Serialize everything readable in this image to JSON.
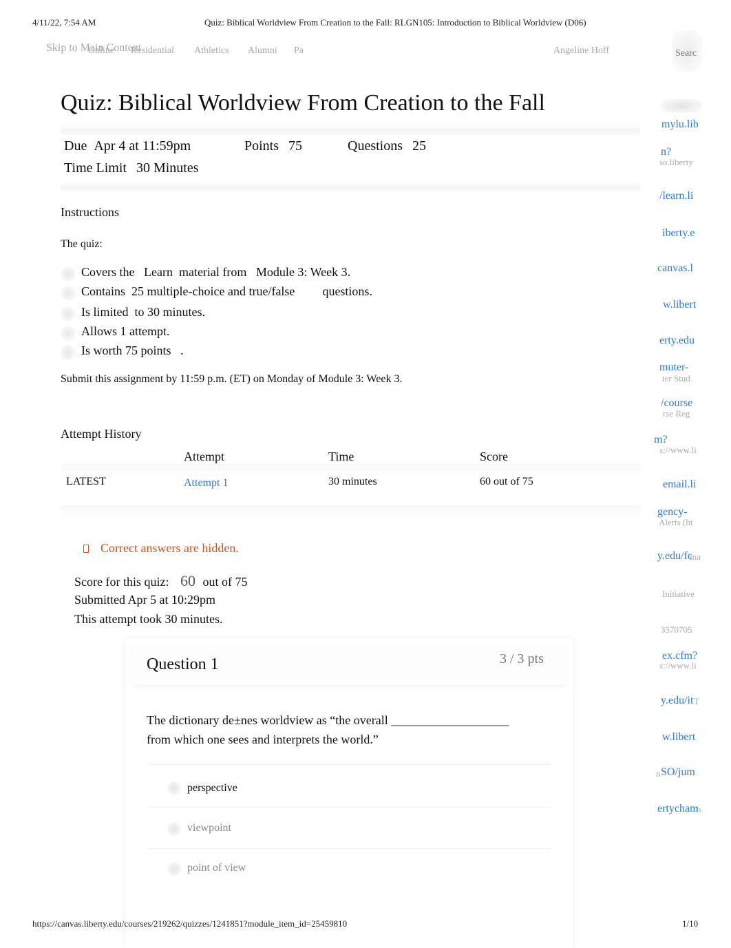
{
  "print_header": {
    "datetime": "4/11/22, 7:54 AM",
    "doc_title": "Quiz: Biblical Worldview From Creation to the Fall: RLGN105: Introduction to Biblical Worldview (D06)"
  },
  "nav": {
    "skip_link": "Skip to Main Content",
    "items": [
      "Online",
      "Residential",
      "Athletics",
      "Alumni",
      "Pa"
    ],
    "user_name": "Angeline Hoff",
    "search_label": "Searc"
  },
  "quiz": {
    "title": "Quiz: Biblical Worldview From Creation to the Fall",
    "due_label": "Due",
    "due_value": "Apr 4 at 11:59pm",
    "points_label": "Points",
    "points_value": "75",
    "questions_label": "Questions",
    "questions_value": "25",
    "time_limit_label": "Time Limit",
    "time_limit_value": "30 Minutes"
  },
  "instructions": {
    "heading": "Instructions",
    "intro": "The quiz:",
    "items": [
      [
        "Covers the",
        "Learn",
        "material from",
        "Module 3: Week 3."
      ],
      [
        "Contains",
        "25 multiple-choice and true/false",
        "questions."
      ],
      [
        "Is limited",
        "to",
        "30 minutes."
      ],
      [
        "Allows 1 attempt."
      ],
      [
        "Is worth 75 points",
        "."
      ]
    ],
    "submit_note": "Submit this assignment by 11:59 p.m. (ET) on Monday of Module 3: Week 3."
  },
  "attempt_history": {
    "heading": "Attempt History",
    "columns": [
      "",
      "Attempt",
      "Time",
      "Score"
    ],
    "rows": [
      {
        "tag": "LATEST",
        "attempt": "Attempt 1",
        "time": "30 minutes",
        "score": "60 out of 75"
      }
    ]
  },
  "result": {
    "notice": "Correct answers are hidden.",
    "notice_icon": "warning-icon",
    "score_label": "Score for this quiz:",
    "score_value": "60",
    "score_total": "out of 75",
    "submitted": "Submitted Apr 5 at 10:29pm",
    "duration": "This attempt took 30 minutes."
  },
  "question": {
    "title": "Question 1",
    "points": "3 / 3 pts",
    "text": "The dictionary de±nes worldview as “the overall ___________________ from which one sees and interprets the world.”",
    "answers": [
      {
        "label": "perspective",
        "selected": true
      },
      {
        "label": "viewpoint",
        "selected": false
      },
      {
        "label": "point of view",
        "selected": false
      }
    ]
  },
  "right_fragments": {
    "links": [
      "mylu.lib",
      "n?",
      "/learn.li",
      "iberty.e",
      "canvas.l",
      "w.libert",
      "erty.edu",
      "muter-",
      "/course",
      "m?",
      "email.li",
      "gency-",
      "y.edu/fc",
      "ex.cfm?",
      "y.edu/it",
      "w.libert",
      "SO/jum",
      "ertycham"
    ],
    "grey": [
      "so.liberty",
      "ter Stud",
      "rse Reg",
      "s://www.li",
      "Alerts  (ht",
      "ina",
      "Initiative",
      "3570705",
      "s://www.li",
      "T",
      "n",
      "h"
    ]
  },
  "print_footer": {
    "url": "https://canvas.liberty.edu/courses/219262/quizzes/1241851?module_item_id=25459810",
    "page": "1/10"
  },
  "colors": {
    "link": "#2d7bd0",
    "warning": "#d0541e",
    "muted": "#aaaaaa"
  }
}
